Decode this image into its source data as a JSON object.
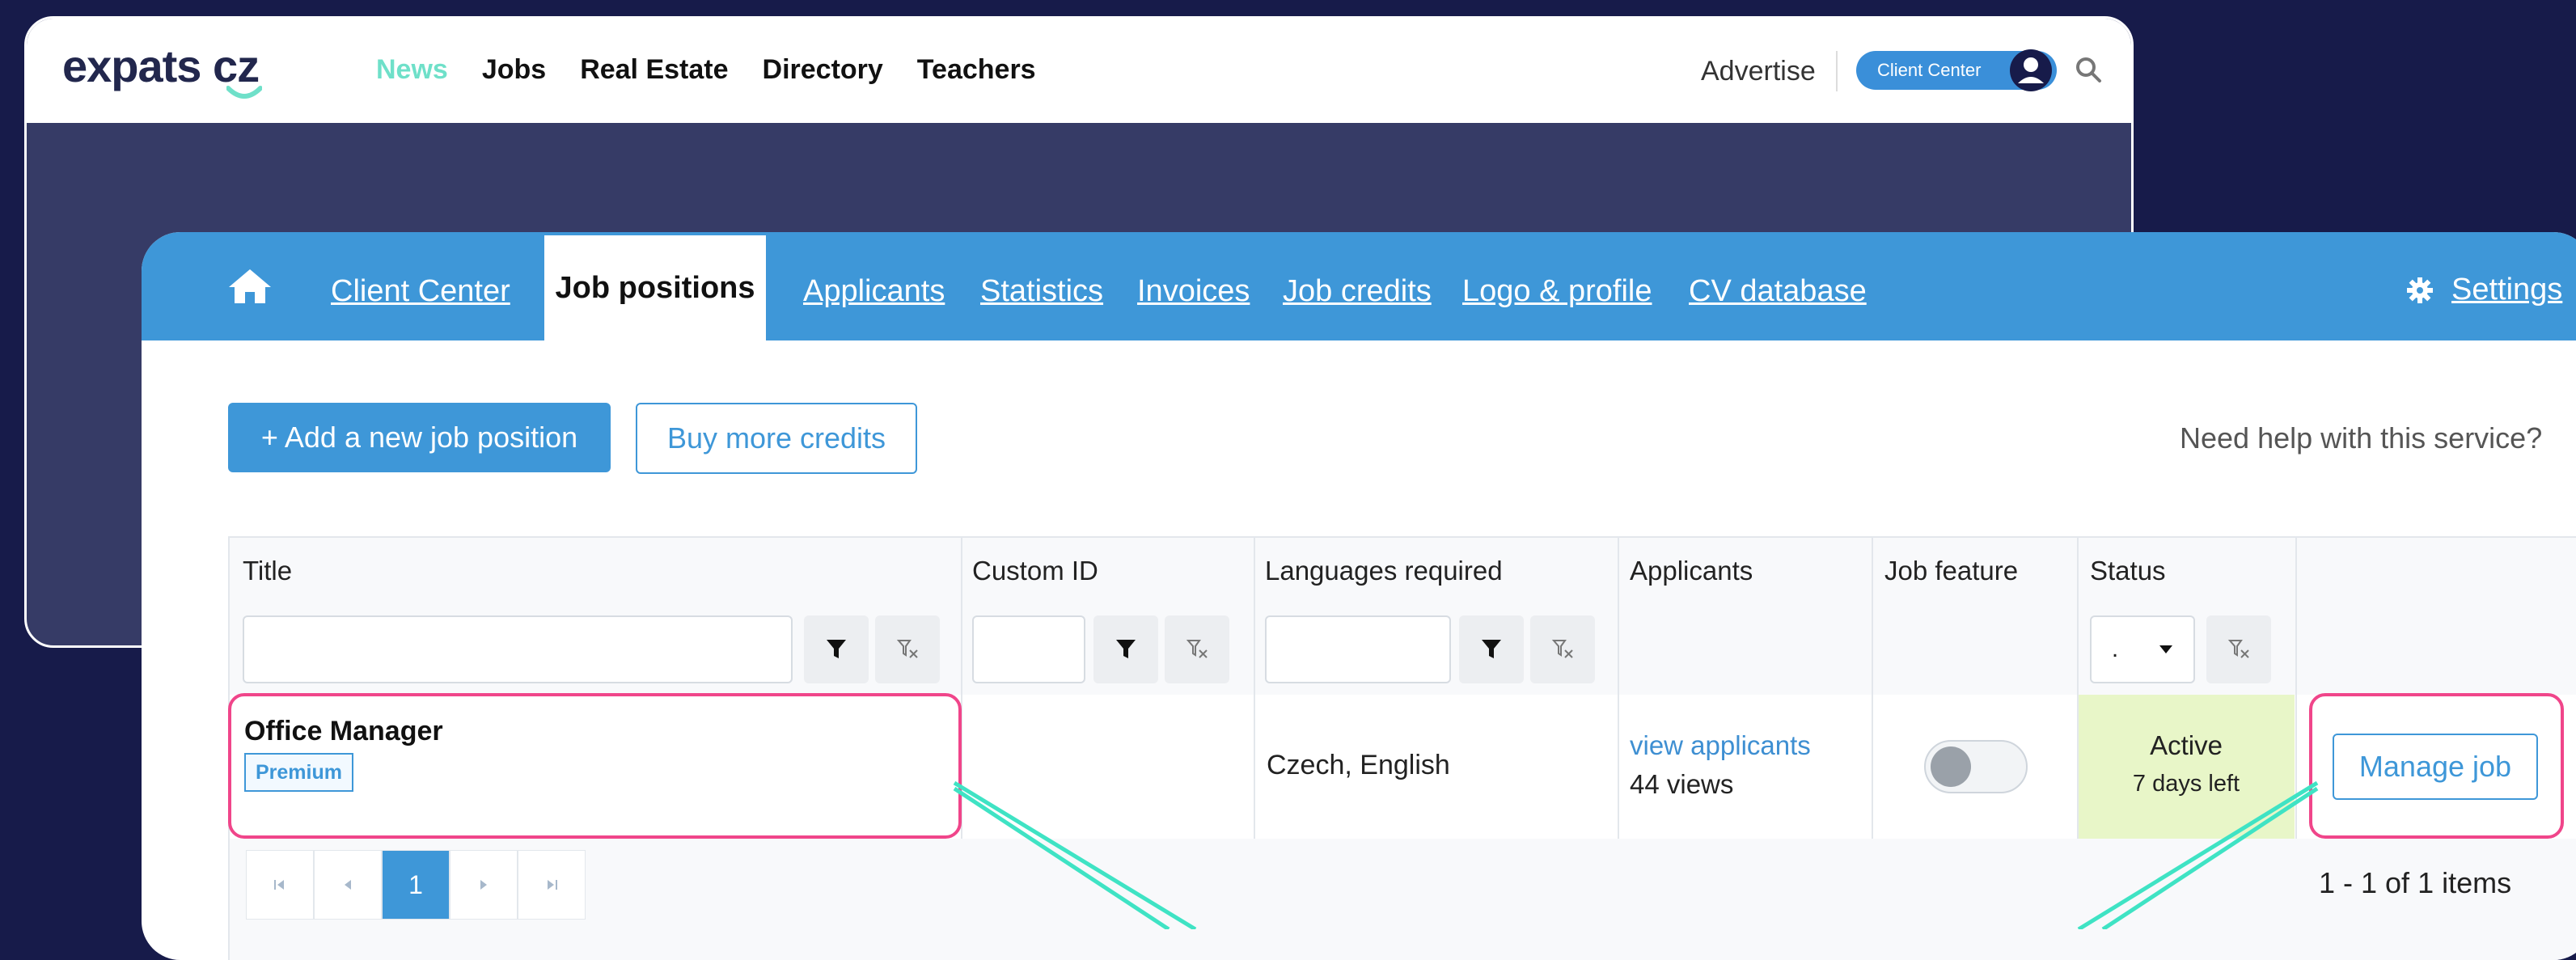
{
  "site": {
    "logo_text": "expats cz",
    "nav": [
      "News",
      "Jobs",
      "Real Estate",
      "Directory",
      "Teachers"
    ],
    "advertise": "Advertise",
    "client_center": "Client Center"
  },
  "tabs": {
    "client_center": "Client Center",
    "job_positions": "Job positions",
    "applicants": "Applicants",
    "statistics": "Statistics",
    "invoices": "Invoices",
    "job_credits": "Job credits",
    "logo_profile": "Logo & profile",
    "cv_database": "CV database",
    "settings": "Settings"
  },
  "actions": {
    "add_job": "+ Add a new job position",
    "buy_credits": "Buy more credits",
    "help": "Need help with this service?"
  },
  "table": {
    "columns": [
      "Title",
      "Custom ID",
      "Languages required",
      "Applicants",
      "Job feature",
      "Status"
    ],
    "status_filter_value": ".",
    "rows": [
      {
        "title": "Office Manager",
        "badge": "Premium",
        "custom_id": "",
        "languages": "Czech, English",
        "applicants_link": "view applicants",
        "views": "44 views",
        "job_feature_enabled": false,
        "status": "Active",
        "days_left": "7 days left",
        "action": "Manage job"
      }
    ],
    "pager": {
      "current_page": "1",
      "summary": "1 - 1 of 1 items"
    }
  },
  "colors": {
    "background": "#171b4a",
    "accent_blue": "#3e97d8",
    "highlight_pink": "#f0458a",
    "callout_teal": "#3fe3c4",
    "status_green": "#e8f6c8",
    "news_teal": "#6fe0c9"
  }
}
